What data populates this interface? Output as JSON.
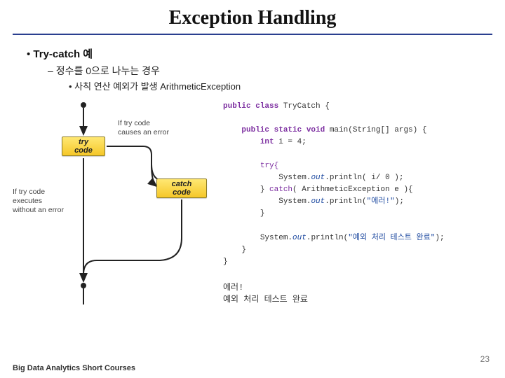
{
  "title": "Exception Handling",
  "bullets": {
    "l1": "Try-catch 예",
    "l2": "정수를 0으로 나누는 경우",
    "l3": "사칙 연산 예외가 발생 ArithmeticException"
  },
  "diagram": {
    "try_label": "try code",
    "catch_label": "catch code",
    "error_label_1": "If try code",
    "error_label_2": "causes an error",
    "noerror_label_1": "If try code executes",
    "noerror_label_2": "without an error"
  },
  "code": {
    "line1a": "public class",
    "line1b": " TryCatch {",
    "line2a": "public static void",
    "line2b": " main(String[] args) {",
    "line3a": "int",
    "line3b": " i = 4;",
    "line4": "try{",
    "line5a": "    System.",
    "line5field": "out",
    "line5b": ".println( i/ 0 );",
    "line6a": "} ",
    "line6b": "catch",
    "line6c": "( ArithmeticException e ){",
    "line7a": "    System.",
    "line7field": "out",
    "line7b": ".println(",
    "line7str": "\"에러!\"",
    "line7c": ");",
    "line8": "}",
    "line9a": "System.",
    "line9field": "out",
    "line9b": ".println(",
    "line9str": "\"예외 처리 테스트 완료\"",
    "line9c": ");",
    "close1": "}",
    "close2": "}"
  },
  "output": {
    "line1": "에러!",
    "line2": "예외 처리 테스트 완료"
  },
  "footer": "Big Data Analytics Short Courses",
  "page": "23"
}
